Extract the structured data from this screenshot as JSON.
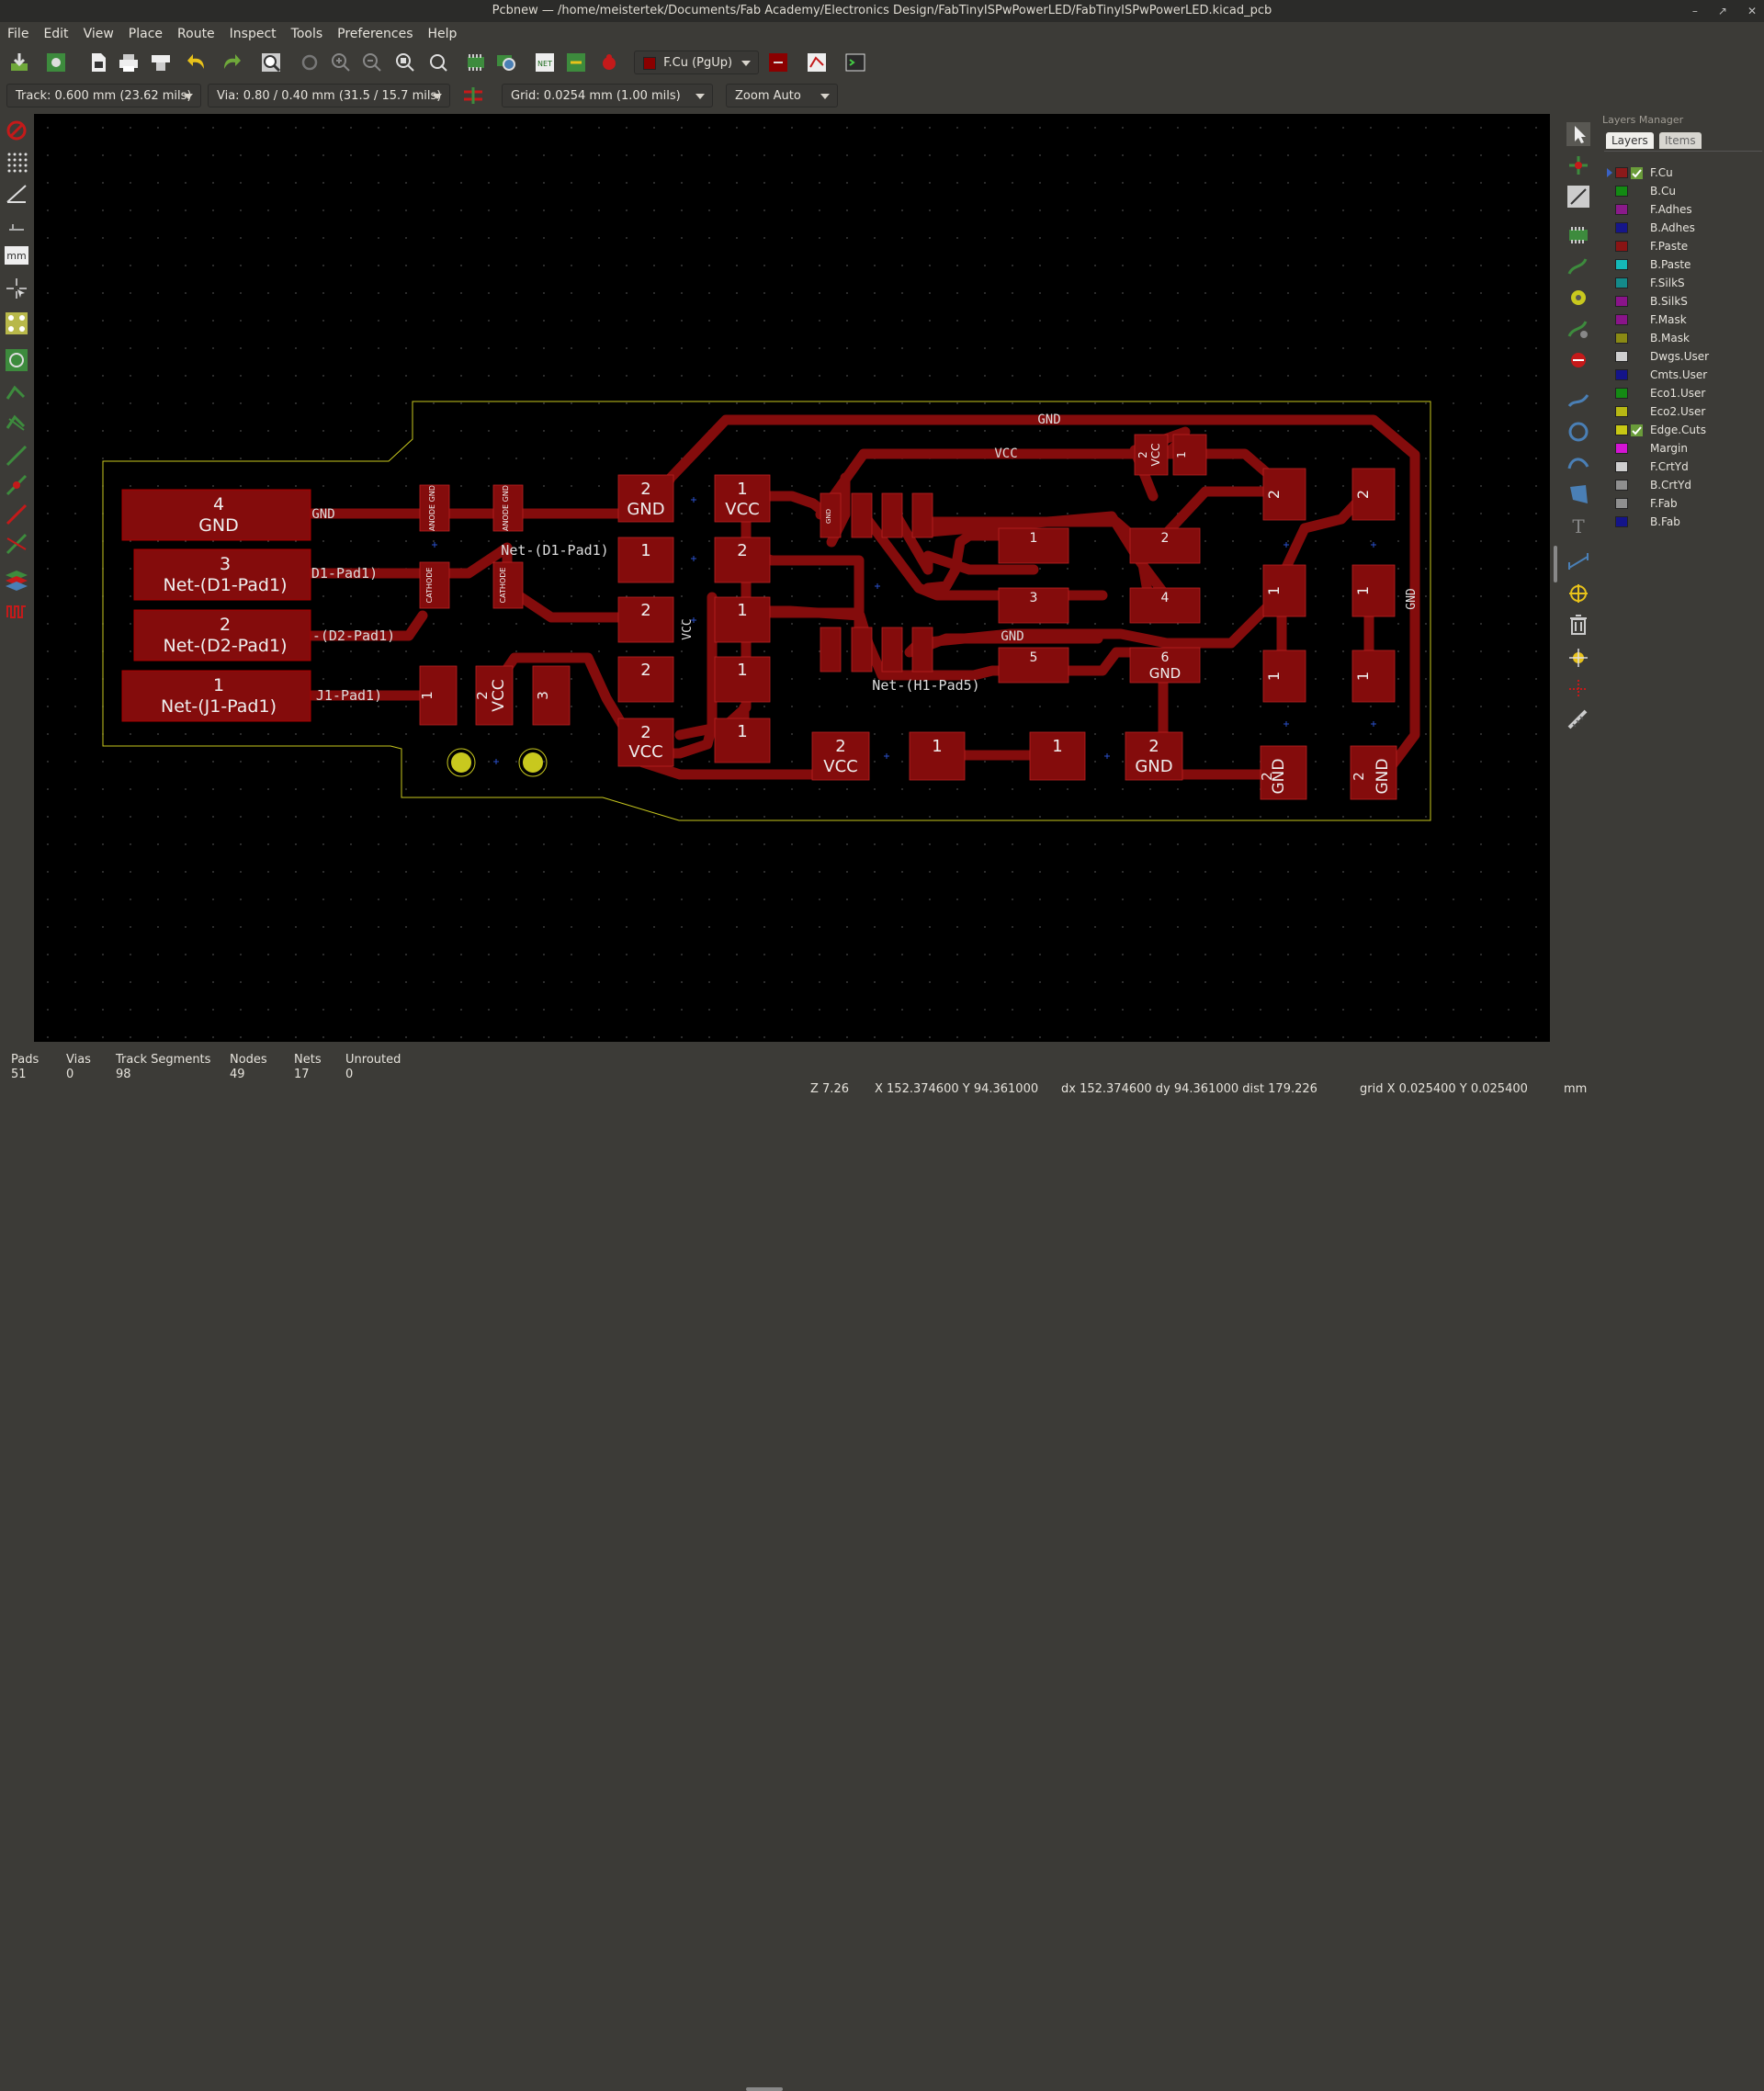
{
  "window": {
    "title": "Pcbnew — /home/meistertek/Documents/Fab Academy/Electronics Design/FabTinyISPwPowerLED/FabTinyISPwPowerLED.kicad_pcb",
    "controls": [
      "–",
      "↗",
      "✕"
    ]
  },
  "menu": [
    "File",
    "Edit",
    "View",
    "Place",
    "Route",
    "Inspect",
    "Tools",
    "Preferences",
    "Help"
  ],
  "toolbar": {
    "layer_select": "F.Cu (PgUp)",
    "layer_color": "#8b0000"
  },
  "auxbar": {
    "track": "Track: 0.600 mm (23.62 mils) *",
    "via": "Via: 0.80 / 0.40 mm (31.5 / 15.7 mils) *",
    "grid": "Grid: 0.0254 mm (1.00 mils)",
    "zoom": "Zoom Auto"
  },
  "layers_manager": {
    "title": "Layers Manager",
    "tabs": [
      "Layers",
      "Items"
    ],
    "layers": [
      {
        "name": "F.Cu",
        "color": "#8c1a1a",
        "checked": true,
        "active": true
      },
      {
        "name": "B.Cu",
        "color": "#138a13",
        "checked": false
      },
      {
        "name": "F.Adhes",
        "color": "#8a1a8a",
        "checked": false
      },
      {
        "name": "B.Adhes",
        "color": "#16168a",
        "checked": false
      },
      {
        "name": "F.Paste",
        "color": "#8a1414",
        "checked": false
      },
      {
        "name": "B.Paste",
        "color": "#14b8b8",
        "checked": false
      },
      {
        "name": "F.SilkS",
        "color": "#148a8a",
        "checked": false
      },
      {
        "name": "B.SilkS",
        "color": "#8a148a",
        "checked": false
      },
      {
        "name": "F.Mask",
        "color": "#8a148a",
        "checked": false
      },
      {
        "name": "B.Mask",
        "color": "#8a8a14",
        "checked": false
      },
      {
        "name": "Dwgs.User",
        "color": "#cfcfcf",
        "checked": false
      },
      {
        "name": "Cmts.User",
        "color": "#14148a",
        "checked": false
      },
      {
        "name": "Eco1.User",
        "color": "#148a14",
        "checked": false
      },
      {
        "name": "Eco2.User",
        "color": "#b8b814",
        "checked": false
      },
      {
        "name": "Edge.Cuts",
        "color": "#c8c814",
        "checked": true
      },
      {
        "name": "Margin",
        "color": "#d414d4",
        "checked": false
      },
      {
        "name": "F.CrtYd",
        "color": "#cfcfcf",
        "checked": false
      },
      {
        "name": "B.CrtYd",
        "color": "#8f8f8f",
        "checked": false
      },
      {
        "name": "F.Fab",
        "color": "#8f8f8f",
        "checked": false
      },
      {
        "name": "B.Fab",
        "color": "#14148a",
        "checked": false
      }
    ]
  },
  "board": {
    "connector_pads": [
      {
        "num": "4",
        "net": "GND"
      },
      {
        "num": "3",
        "net": "Net-(D1-Pad1)"
      },
      {
        "num": "2",
        "net": "Net-(D2-Pad1)"
      },
      {
        "num": "1",
        "net": "Net-(J1-Pad1)"
      }
    ],
    "track_labels": [
      "GND",
      "VCC",
      "GND",
      "Net-(D1-Pad1)",
      "D1-Pad1)",
      "-(D2-Pad1)",
      "J1-Pad1)",
      "VCC",
      "GND",
      "Net-(H1-Pad5)",
      "GND"
    ],
    "pads": [
      {
        "num": "2",
        "net": "GND"
      },
      {
        "num": "1",
        "net": "VCC"
      },
      {
        "num": "1",
        "net": ""
      },
      {
        "num": "2",
        "net": ""
      },
      {
        "num": "2",
        "net": ""
      },
      {
        "num": "1",
        "net": ""
      },
      {
        "num": "2",
        "net": ""
      },
      {
        "num": "1",
        "net": ""
      },
      {
        "num": "2",
        "net": "VCC"
      },
      {
        "num": "1",
        "net": ""
      },
      {
        "num": "2",
        "net": "VCC"
      },
      {
        "num": "1",
        "net": ""
      },
      {
        "num": "1",
        "net": ""
      },
      {
        "num": "2",
        "net": "GND"
      },
      {
        "num": "2",
        "net": "GND"
      },
      {
        "num": "2",
        "net": "GND"
      },
      {
        "num": "1",
        "net": ""
      },
      {
        "num": "2",
        "net": ""
      },
      {
        "num": "3",
        "net": ""
      },
      {
        "num": "4",
        "net": ""
      },
      {
        "num": "5",
        "net": ""
      },
      {
        "num": "6",
        "net": "GND"
      },
      {
        "num": "2",
        "net": ""
      },
      {
        "num": "2",
        "net": ""
      },
      {
        "num": "1",
        "net": ""
      },
      {
        "num": "1",
        "net": ""
      },
      {
        "num": "1",
        "net": ""
      },
      {
        "num": "1",
        "net": ""
      },
      {
        "num": "2",
        "net": "VCC"
      },
      {
        "num": "1",
        "net": ""
      },
      {
        "num": "1",
        "net": ""
      },
      {
        "num": "2",
        "net": "VCC"
      },
      {
        "num": "3",
        "net": ""
      },
      {
        "num": "",
        "net": "ANODE GND"
      },
      {
        "num": "",
        "net": "ANODE GND"
      },
      {
        "num": "",
        "net": "CATHODE"
      },
      {
        "num": "",
        "net": "CATHODE"
      },
      {
        "num": "",
        "net": "GND"
      }
    ]
  },
  "status": {
    "pads_label": "Pads",
    "pads": "51",
    "vias_label": "Vias",
    "vias": "0",
    "segments_label": "Track Segments",
    "segments": "98",
    "nodes_label": "Nodes",
    "nodes": "49",
    "nets_label": "Nets",
    "nets": "17",
    "unrouted_label": "Unrouted",
    "unrouted": "0"
  },
  "coords": {
    "zoom": "Z 7.26",
    "xy": "X 152.374600  Y 94.361000",
    "delta": "dx 152.374600  dy 94.361000  dist 179.226",
    "grid": "grid X 0.025400  Y 0.025400",
    "units": "mm"
  }
}
